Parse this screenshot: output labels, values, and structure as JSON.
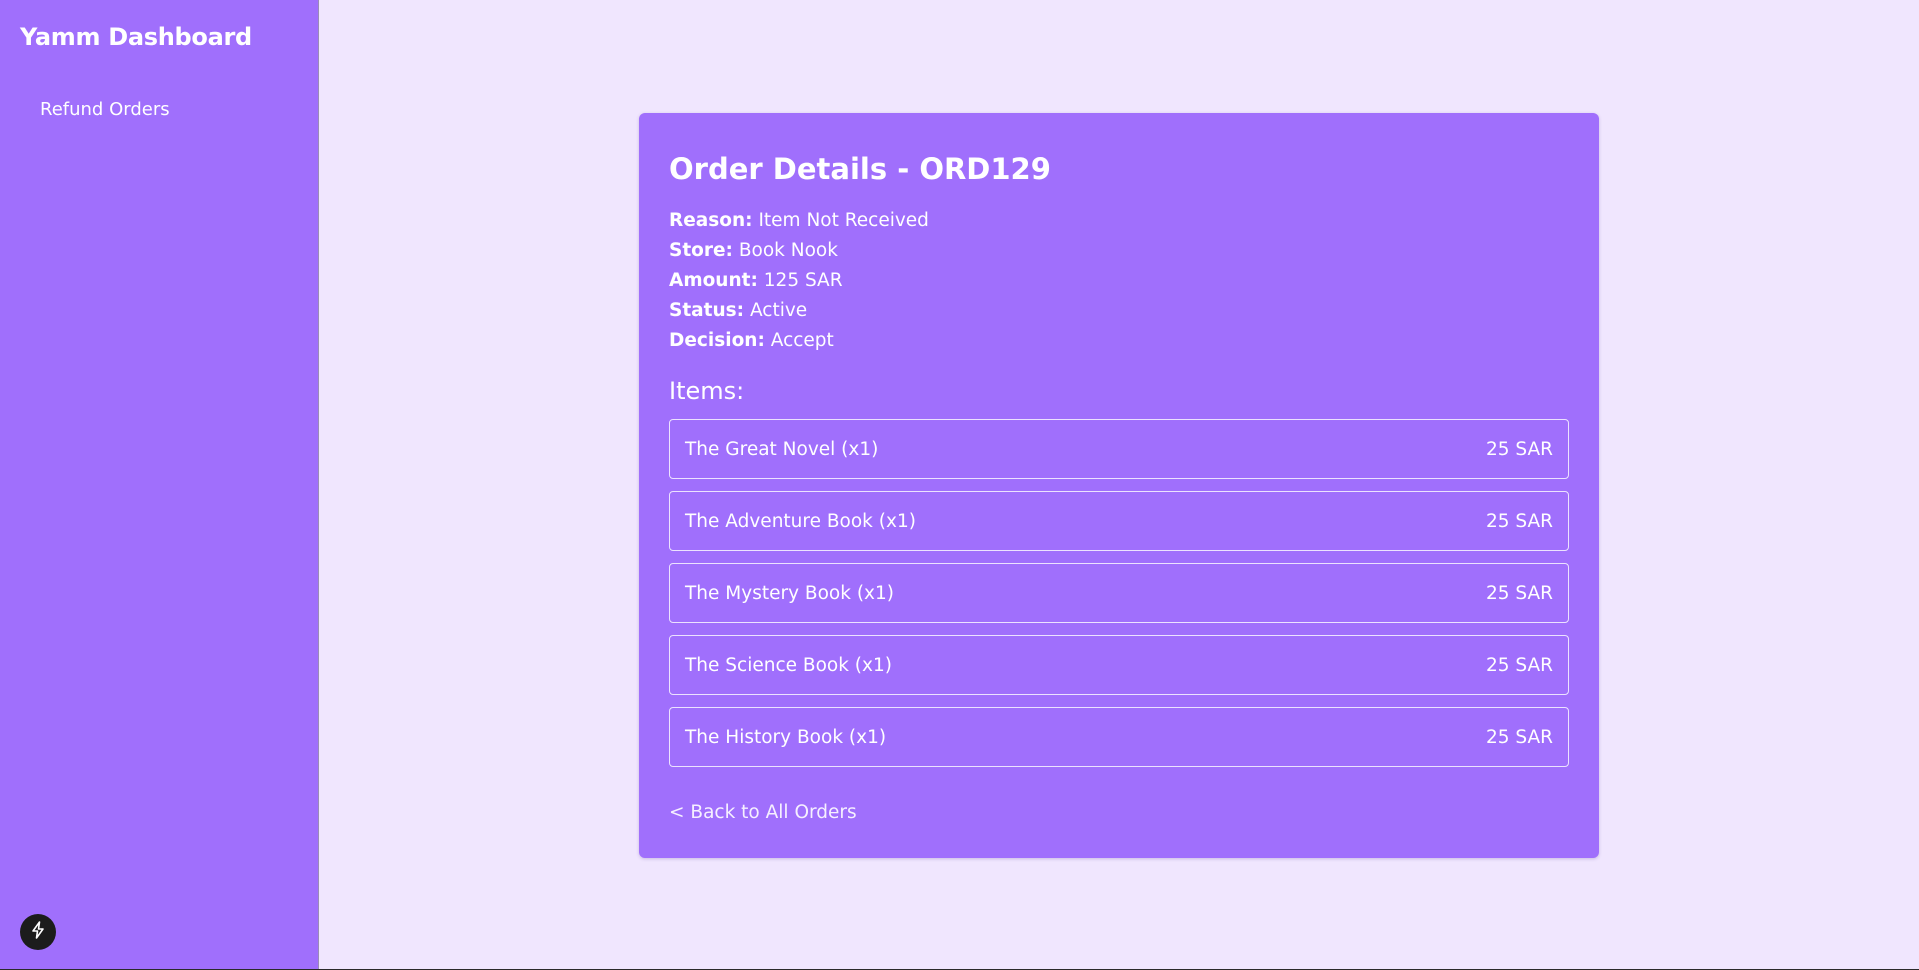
{
  "sidebar": {
    "brand": "Yamm Dashboard",
    "nav": [
      {
        "label": "Refund Orders"
      }
    ],
    "fab_icon": "lightning-bolt-icon"
  },
  "order": {
    "title": "Order Details - ORD129",
    "details": [
      {
        "key": "Reason:",
        "value": "Item Not Received"
      },
      {
        "key": "Store:",
        "value": "Book Nook"
      },
      {
        "key": "Amount:",
        "value": "125 SAR"
      },
      {
        "key": "Status:",
        "value": "Active"
      },
      {
        "key": "Decision:",
        "value": "Accept"
      }
    ],
    "items_heading": "Items:",
    "items": [
      {
        "name": "The Great Novel (x1)",
        "price": "25 SAR"
      },
      {
        "name": "The Adventure Book (x1)",
        "price": "25 SAR"
      },
      {
        "name": "The Mystery Book (x1)",
        "price": "25 SAR"
      },
      {
        "name": "The Science Book (x1)",
        "price": "25 SAR"
      },
      {
        "name": "The History Book (x1)",
        "price": "25 SAR"
      }
    ],
    "back_link": "< Back to All Orders"
  },
  "colors": {
    "page_background": "#f0e6fe",
    "sidebar_background": "#a06ffc",
    "card_background": "#a06ffc",
    "text": "#ffffff",
    "fab_background": "#1c1c1c"
  }
}
